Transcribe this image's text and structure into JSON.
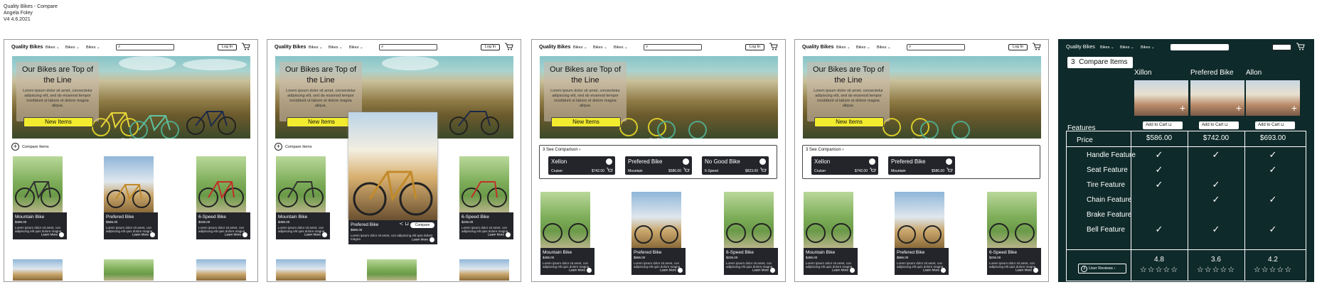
{
  "caption": {
    "line1": "Quality Bikes - Compare",
    "line2": "Angela Foley",
    "line3": "V4   4.6.2021"
  },
  "nav": {
    "logo": "Quality Bikes",
    "menu": [
      "Bikes",
      "Bikes",
      "Bikes"
    ],
    "login": "Log In"
  },
  "hero": {
    "title": "Our Bikes are Top of the Line",
    "text": "Lorem ipsum dolor sit amet, consectetur adipiscing elit, sed do eiusmod tempor incididunt ut labore et dolore magna aliqua.",
    "button": "New Items"
  },
  "compare_items_label": "Compare Items",
  "products": [
    {
      "name": "Mountain Bike",
      "price": "$485.00",
      "desc": "Lorem ipsum dolor sit amet, con adipiscing elit quis dolore magna",
      "learn": "Learn More"
    },
    {
      "name": "Prefered Bike",
      "price": "$586.00",
      "desc": "Lorem ipsum dolor sit amet, con adipiscing elit quis dolore magna",
      "learn": "Learn More"
    },
    {
      "name": "6-Speed Bike",
      "price": "$236.00",
      "desc": "Lorem ipsum dolor sit amet, con adipiscing elit quis dolore magna",
      "learn": "Learn More"
    }
  ],
  "popup": {
    "name": "Prefered Bike",
    "price": "$586.00",
    "desc": "Lorem ipsum dolor sit amet, con adipiscing elit quis dolore magna",
    "compare": "Compare",
    "learn": "Learn More"
  },
  "see_comparison": {
    "count": "3",
    "label": "See Comparison"
  },
  "chips_frame3": [
    {
      "name": "Xellon",
      "sub": "Cruiser",
      "price": "$742.00"
    },
    {
      "name": "Prefered Bike",
      "sub": "Mountain",
      "price": "$586.00"
    },
    {
      "name": "No Good Bike",
      "sub": "6-Speed",
      "price": "$823.00"
    }
  ],
  "chips_frame4": [
    {
      "name": "Xellon",
      "sub": "Cruiser",
      "price": "$742.00"
    },
    {
      "name": "Prefered Bike",
      "sub": "Mountain",
      "price": "$586.00"
    }
  ],
  "compare_page": {
    "count": "3",
    "title": "Compare Items",
    "columns": [
      "Xillon",
      "Prefered Bike",
      "Allon"
    ],
    "add_to_cart": "Add to Cart",
    "features_label": "Features",
    "rows": [
      "Price",
      "Handle Feature",
      "Seat Feature",
      "Tire Feature",
      "Chain Feature",
      "Brake Feature",
      "Bell Feature"
    ],
    "prices": [
      "$586.00",
      "$742.00",
      "$693.00"
    ],
    "checks": [
      [
        true,
        true,
        true
      ],
      [
        true,
        false,
        true
      ],
      [
        true,
        true,
        false
      ],
      [
        false,
        true,
        true
      ],
      [
        false,
        false,
        false
      ],
      [
        true,
        true,
        true
      ]
    ],
    "ratings": [
      "4.8",
      "3.6",
      "4.2"
    ],
    "stars": "☆☆☆☆☆",
    "reviews_count": "3",
    "reviews_label": "User Reviews"
  },
  "colors": {
    "dark_bg": "#0f2a2a",
    "card_bg": "#23252b",
    "accent_yellow": "#f3ec2e"
  }
}
